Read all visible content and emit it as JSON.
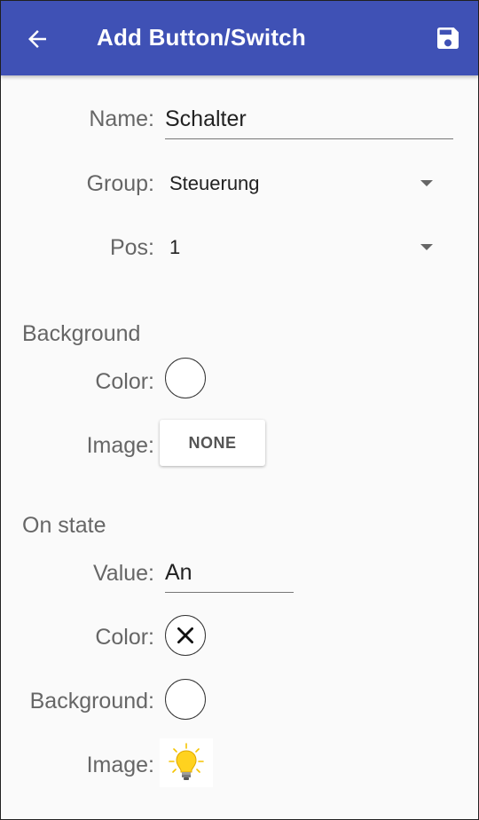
{
  "appbar": {
    "title": "Add Button/Switch",
    "back_icon": "arrow-left-icon",
    "save_icon": "save-icon",
    "color": "#3f51b5"
  },
  "form": {
    "name_label": "Name:",
    "name_value": "Schalter",
    "group_label": "Group:",
    "group_value": "Steuerung",
    "pos_label": "Pos:",
    "pos_value": "1"
  },
  "background": {
    "header": "Background",
    "color_label": "Color:",
    "color_value": "#ffffff",
    "image_label": "Image:",
    "image_button": "NONE"
  },
  "on_state": {
    "header": "On state",
    "value_label": "Value:",
    "value": "An",
    "color_label": "Color:",
    "color_icon": "close-x-icon",
    "background_label": "Background:",
    "background_value": "#ffffff",
    "image_label": "Image:",
    "image_icon": "lightbulb-icon"
  }
}
